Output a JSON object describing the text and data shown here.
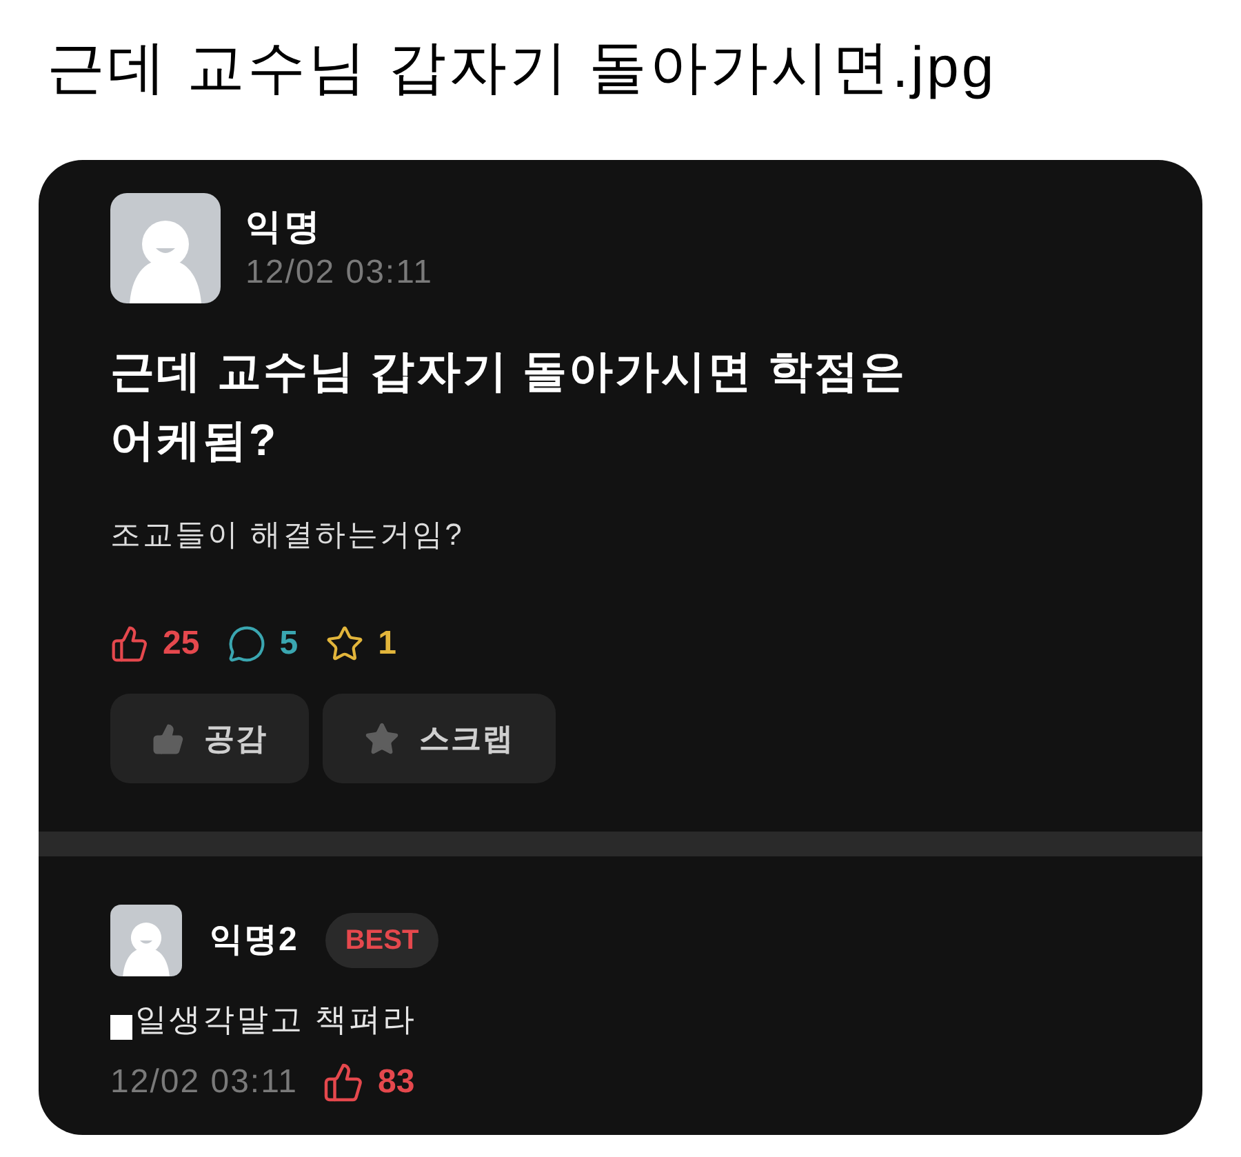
{
  "page_title": "근데 교수님 갑자기 돌아가시면.jpg",
  "post": {
    "author": "익명",
    "time": "12/02 03:11",
    "title": "근데 교수님 갑자기 돌아가시면 학점은 어케됨?",
    "body": "조교들이 해결하는거임?",
    "stats": [
      {
        "kind": "like",
        "count": "25",
        "color": "#e5484d"
      },
      {
        "kind": "comment",
        "count": "5",
        "color": "#3aa6b0"
      },
      {
        "kind": "scrap",
        "count": "1",
        "color": "#e2b53b"
      }
    ],
    "actions": [
      {
        "kind": "like",
        "label": "공감"
      },
      {
        "kind": "scrap",
        "label": "스크랩"
      }
    ]
  },
  "comments": [
    {
      "author": "익명2",
      "badge": "BEST",
      "redacted": true,
      "text": "일생각말고 책펴라",
      "time": "12/02 03:11",
      "likes": "83"
    }
  ]
}
